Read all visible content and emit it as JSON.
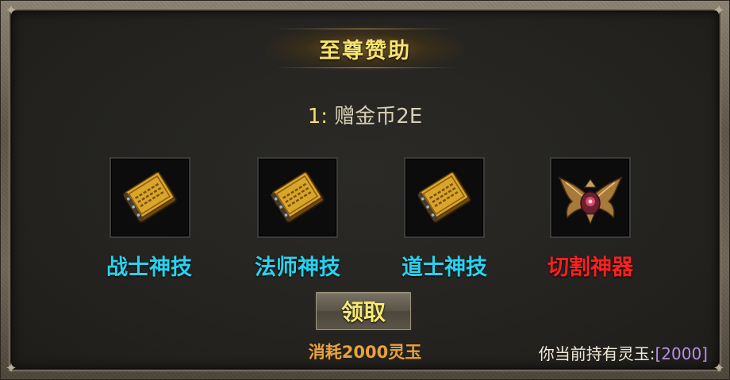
{
  "panel": {
    "title": "至尊赞助"
  },
  "reward": {
    "index": "1:",
    "text": "赠金币2E"
  },
  "items": [
    {
      "name": "战士神技",
      "icon": "skill-book-icon",
      "label_color": "#27d3f0"
    },
    {
      "name": "法师神技",
      "icon": "skill-book-icon",
      "label_color": "#27d3f0"
    },
    {
      "name": "道士神技",
      "icon": "skill-book-icon",
      "label_color": "#27d3f0"
    },
    {
      "name": "切割神器",
      "icon": "winged-artifact-icon",
      "label_color": "#ff2020"
    }
  ],
  "claim": {
    "label": "领取",
    "cost_text": "消耗2000灵玉"
  },
  "holding": {
    "label": "你当前持有灵玉:",
    "value": "[2000]"
  },
  "colors": {
    "title": "#f7e36c",
    "class_label": "#27d3f0",
    "artifact_label": "#ff2020",
    "cost": "#e8a23c",
    "holding_value": "#b88ee8"
  }
}
